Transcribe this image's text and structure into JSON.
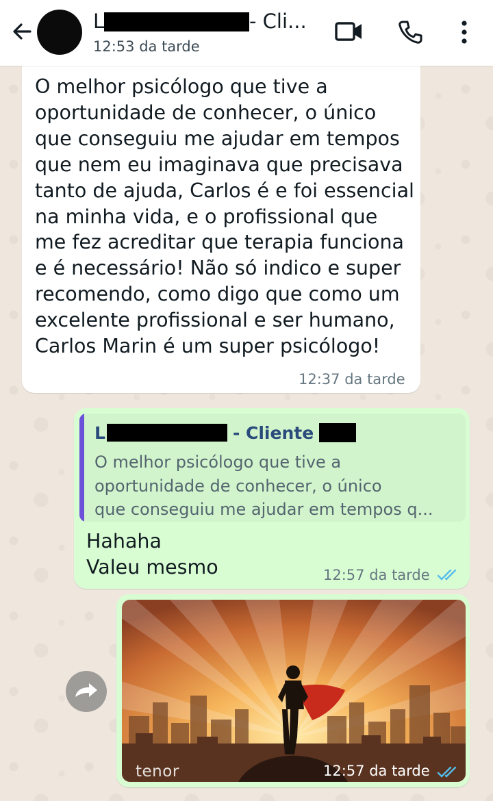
{
  "header": {
    "title": "L- Cli...",
    "title_prefix": "L",
    "title_suffix": "- Cli...",
    "last_seen": "12:53 da tarde",
    "icons": [
      "back-arrow-icon",
      "video-call-icon",
      "phone-icon",
      "more-vert-icon"
    ]
  },
  "messages": {
    "incoming": {
      "lines": [
        "O melhor psicólogo que tive a",
        "oportunidade de conhecer, o único",
        "que conseguiu me ajudar em tempos",
        "que nem eu imaginava que precisava",
        "tanto de ajuda, Carlos é e foi essencial",
        "na minha vida, e o profissional que",
        "me fez acreditar que terapia funciona",
        "e é necessário! Não só indico e super",
        "recomendo, como digo que como um",
        "excelente profissional e ser humano,",
        "Carlos Marin é um super psicólogo!"
      ],
      "time": "12:37 da tarde"
    },
    "reply": {
      "quote_author_prefix": "L",
      "quote_author_suffix": "- Cliente",
      "quote_lines": [
        "O melhor psicólogo que tive a",
        "oportunidade de conhecer, o único",
        "que conseguiu me ajudar em tempos q..."
      ],
      "lines": [
        "Hahaha",
        "Valeu mesmo"
      ],
      "time": "12:57 da tarde",
      "status": "read"
    },
    "gif": {
      "provider": "tenor",
      "time": "12:57 da tarde",
      "status": "read"
    }
  },
  "colors": {
    "outgoing_bubble": "#d9fdd3",
    "incoming_bubble": "#ffffff",
    "read_ticks": "#53bdeb",
    "quote_bar": "#6c52d8"
  }
}
